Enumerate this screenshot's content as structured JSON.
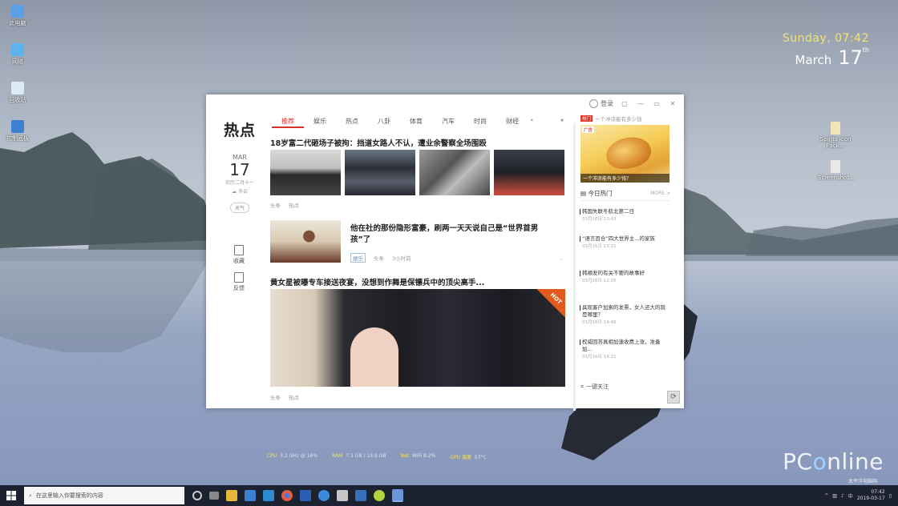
{
  "desktop": {
    "icons_left": [
      {
        "label": "此电脑",
        "color": "#5aa0e6"
      },
      {
        "label": "网络",
        "color": "#5fb2f0"
      },
      {
        "label": "回收站",
        "color": "#dde9f5"
      },
      {
        "label": "控制面板",
        "color": "#3d7fd0"
      }
    ],
    "icons_right": [
      {
        "label": "Spirits Icon Pack...",
        "color": "#f2e6b8"
      },
      {
        "label": "Screenshot...",
        "color": "#e9e9e9"
      }
    ]
  },
  "clock": {
    "day": "Sunday, 07:42",
    "month": "March",
    "date": "17",
    "suffix": "th"
  },
  "window": {
    "logo": "热点",
    "tabs": [
      "推荐",
      "娱乐",
      "热点",
      "八卦",
      "体育",
      "汽车",
      "时尚",
      "财经"
    ],
    "active_tab": 0,
    "tab_more": "•",
    "login": "登录",
    "date": {
      "month": "MAR",
      "day": "17",
      "lunar": "农历二月十一",
      "weather": "多云",
      "pill": "天气"
    },
    "side_buttons": [
      "收藏",
      "反馈"
    ],
    "articles": [
      {
        "title": "18岁富二代砸场子被拘：挡道女路人不认，遭业余警察全场围殴",
        "source": "头条",
        "extra": "热点"
      },
      {
        "title": "他在社的那份隐形富豪，刷两一天天说自己是“世界首男孩”了",
        "tag": "娱乐",
        "source": "头条",
        "time": "3小时前"
      },
      {
        "title": "黄女星被曝专车接送夜宴，没想到作舞是保镖兵中的顶尖高手...",
        "source": "头条",
        "extra": "热点",
        "hot_badge": "HOT"
      }
    ],
    "right_panel": {
      "top_badge": "热门",
      "top_text": "一个冲凉能有多少钱",
      "ad_tag": "广告",
      "ad_caption": "一个冲凉能有多少钱？",
      "today_title": "今日热门",
      "today_more": "MORE >",
      "hot_items": [
        {
          "title": "韩国失联冬航北第二日",
          "time": "03月16日 13:43"
        },
        {
          "title": "“语言百合”四大世界主...的家族",
          "time": "03月16日 13:21"
        },
        {
          "title": "韩顺发的有关不要的故事好",
          "time": "03月16日 12:05"
        },
        {
          "title": "具现客户加索的发票，女人还大的就是哪里？",
          "time": "03月16日 14:46"
        },
        {
          "title": "权威回答真相加速收费上涨，准备加...",
          "time": "03月16日 14:21"
        }
      ],
      "follow": "一键关注"
    }
  },
  "hardware": [
    {
      "k": "CPU",
      "v": "3.2 GHz @ 16%"
    },
    {
      "k": "RAM",
      "v": "7.1 GB / 15.9 GB"
    },
    {
      "k": "Net",
      "v": "WiFi 8.2%"
    },
    {
      "k": "GPU 温度",
      "v": "57°C"
    }
  ],
  "watermark": {
    "pre": "PC",
    "mid": "o",
    "post": "nline",
    "small": "太平洋电脑网"
  },
  "taskbar": {
    "search_placeholder": "在这里输入你要搜索的内容",
    "apps": [
      {
        "name": "cortana-icon",
        "color": "#cccccc"
      },
      {
        "name": "task-view-icon",
        "color": "#888888"
      },
      {
        "name": "file-explorer-icon",
        "color": "#e8b73a"
      },
      {
        "name": "store-icon",
        "color": "#3d7fd0"
      },
      {
        "name": "photos-icon",
        "color": "#2f8bd1"
      },
      {
        "name": "chrome-icon",
        "color": "#e25b45"
      },
      {
        "name": "word-icon",
        "color": "#2b5fb5"
      },
      {
        "name": "edge-icon",
        "color": "#3a8bd9"
      },
      {
        "name": "tools-icon",
        "color": "#c7c7c7"
      },
      {
        "name": "mail-icon",
        "color": "#3770b8"
      },
      {
        "name": "leaf-icon",
        "color": "#b4d340"
      },
      {
        "name": "news-app-icon",
        "color": "#6a96d8"
      }
    ],
    "tray_time": "07:42",
    "tray_date": "2019-03-17"
  }
}
